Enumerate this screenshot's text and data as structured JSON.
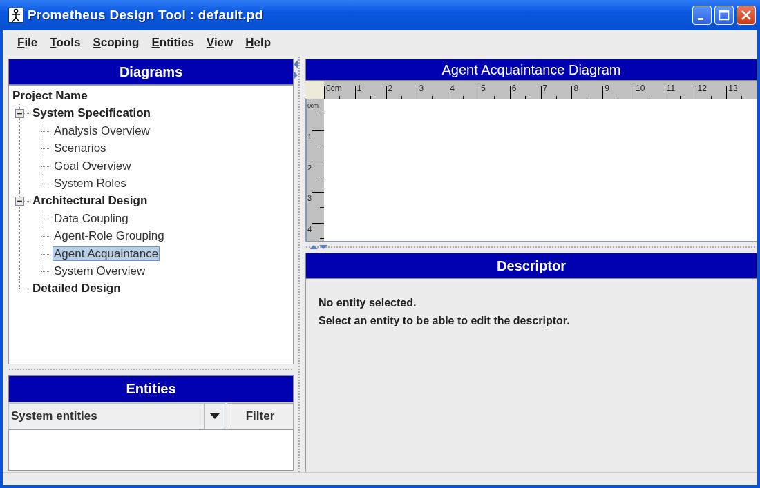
{
  "window": {
    "title": "Prometheus Design Tool : default.pd"
  },
  "menu": [
    "File",
    "Tools",
    "Scoping",
    "Entities",
    "View",
    "Help"
  ],
  "diagrams_panel": {
    "title": "Diagrams",
    "tree": [
      {
        "label": "Project Name",
        "kind": "folder",
        "selected": false,
        "children": [
          {
            "label": "System Specification",
            "kind": "folder",
            "selected": false,
            "expanded": true,
            "children": [
              {
                "label": "Analysis Overview",
                "kind": "diagram",
                "selected": false
              },
              {
                "label": "Scenarios",
                "kind": "diagram",
                "selected": false
              },
              {
                "label": "Goal Overview",
                "kind": "diagram",
                "selected": false
              },
              {
                "label": "System Roles",
                "kind": "diagram",
                "selected": false
              }
            ]
          },
          {
            "label": "Architectural Design",
            "kind": "folder",
            "selected": false,
            "expanded": true,
            "children": [
              {
                "label": "Data Coupling",
                "kind": "diagram",
                "selected": false
              },
              {
                "label": "Agent-Role Grouping",
                "kind": "diagram",
                "selected": false
              },
              {
                "label": "Agent Acquaintance",
                "kind": "diagram",
                "selected": true
              },
              {
                "label": "System Overview",
                "kind": "diagram",
                "selected": false
              }
            ]
          },
          {
            "label": "Detailed Design",
            "kind": "folder",
            "selected": false
          }
        ]
      }
    ]
  },
  "entities_panel": {
    "title": "Entities",
    "filter_dropdown": {
      "value": "System entities"
    },
    "filter_button": "Filter"
  },
  "diagram_panel": {
    "title": "Agent Acquaintance Diagram",
    "ruler": {
      "horizontal": [
        "0cm",
        "1",
        "2",
        "3",
        "4",
        "5",
        "6",
        "7",
        "8",
        "9",
        "10",
        "11",
        "12",
        "13"
      ],
      "vertical": [
        "0cm",
        "1",
        "2",
        "3",
        "4"
      ]
    }
  },
  "descriptor_panel": {
    "title": "Descriptor",
    "messages": [
      "No entity selected.",
      "Select an entity to be able to edit the descriptor."
    ]
  }
}
